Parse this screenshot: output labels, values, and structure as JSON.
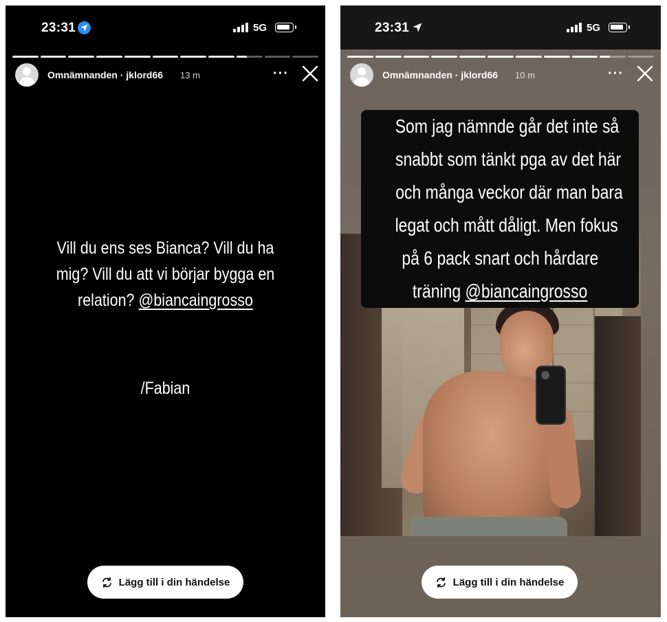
{
  "left": {
    "status": {
      "time": "23:31",
      "network": "5G"
    },
    "header": {
      "username": "Omnämnanden · jklord66",
      "time_ago": "13 m"
    },
    "story_text": {
      "lines": [
        "Vill du ens ses Bianca? Vill du ha",
        "mig? Vill du att vi börjar bygga en",
        "relation? "
      ],
      "mention": "@biancaingrosso",
      "signature": "/Fabian"
    },
    "add_button": "Lägg till i din händelse"
  },
  "right": {
    "status": {
      "time": "23:31",
      "network": "5G"
    },
    "header": {
      "username": "Omnämnanden · jklord66",
      "time_ago": "10 m"
    },
    "caption_lines": [
      "Som jag nämnde går det inte så",
      "snabbt som tänkt pga av det här",
      "och många veckor där man bara",
      "legat och mått dåligt. Men fokus",
      "på 6 pack snart och hårdare",
      "träning "
    ],
    "mention": "@biancaingrosso",
    "add_button": "Lägg till i din händelse"
  },
  "icons": {
    "more": "more-icon",
    "close": "close-icon",
    "add_story": "reshare-icon",
    "location": "location-arrow-icon"
  },
  "colors": {
    "accent_location": "#2f8cf0",
    "story_bg_left": "#000000"
  }
}
